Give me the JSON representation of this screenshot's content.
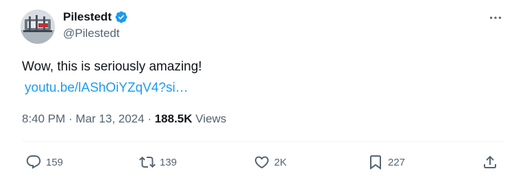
{
  "author": {
    "display_name": "Pilestedt",
    "handle": "@Pilestedt",
    "verified": true
  },
  "tweet": {
    "text": "Wow, this is seriously amazing!",
    "link": "youtu.be/lAShOiYZqV4?si…"
  },
  "meta": {
    "time": "8:40 PM",
    "separator1": " · ",
    "date": "Mar 13, 2024",
    "separator2": " · ",
    "views_count": "188.5K",
    "views_label": " Views"
  },
  "actions": {
    "replies": "159",
    "reposts": "139",
    "likes": "2K",
    "bookmarks": "227"
  },
  "colors": {
    "accent": "#1d9bf0",
    "text": "#0f1419",
    "secondary": "#536471"
  },
  "icons": {
    "avatar": "avatar",
    "verified": "verified-badge-icon",
    "more": "more-horizontal-icon",
    "reply": "reply-icon",
    "repost": "repost-icon",
    "like": "heart-icon",
    "bookmark": "bookmark-icon",
    "share": "share-icon"
  }
}
